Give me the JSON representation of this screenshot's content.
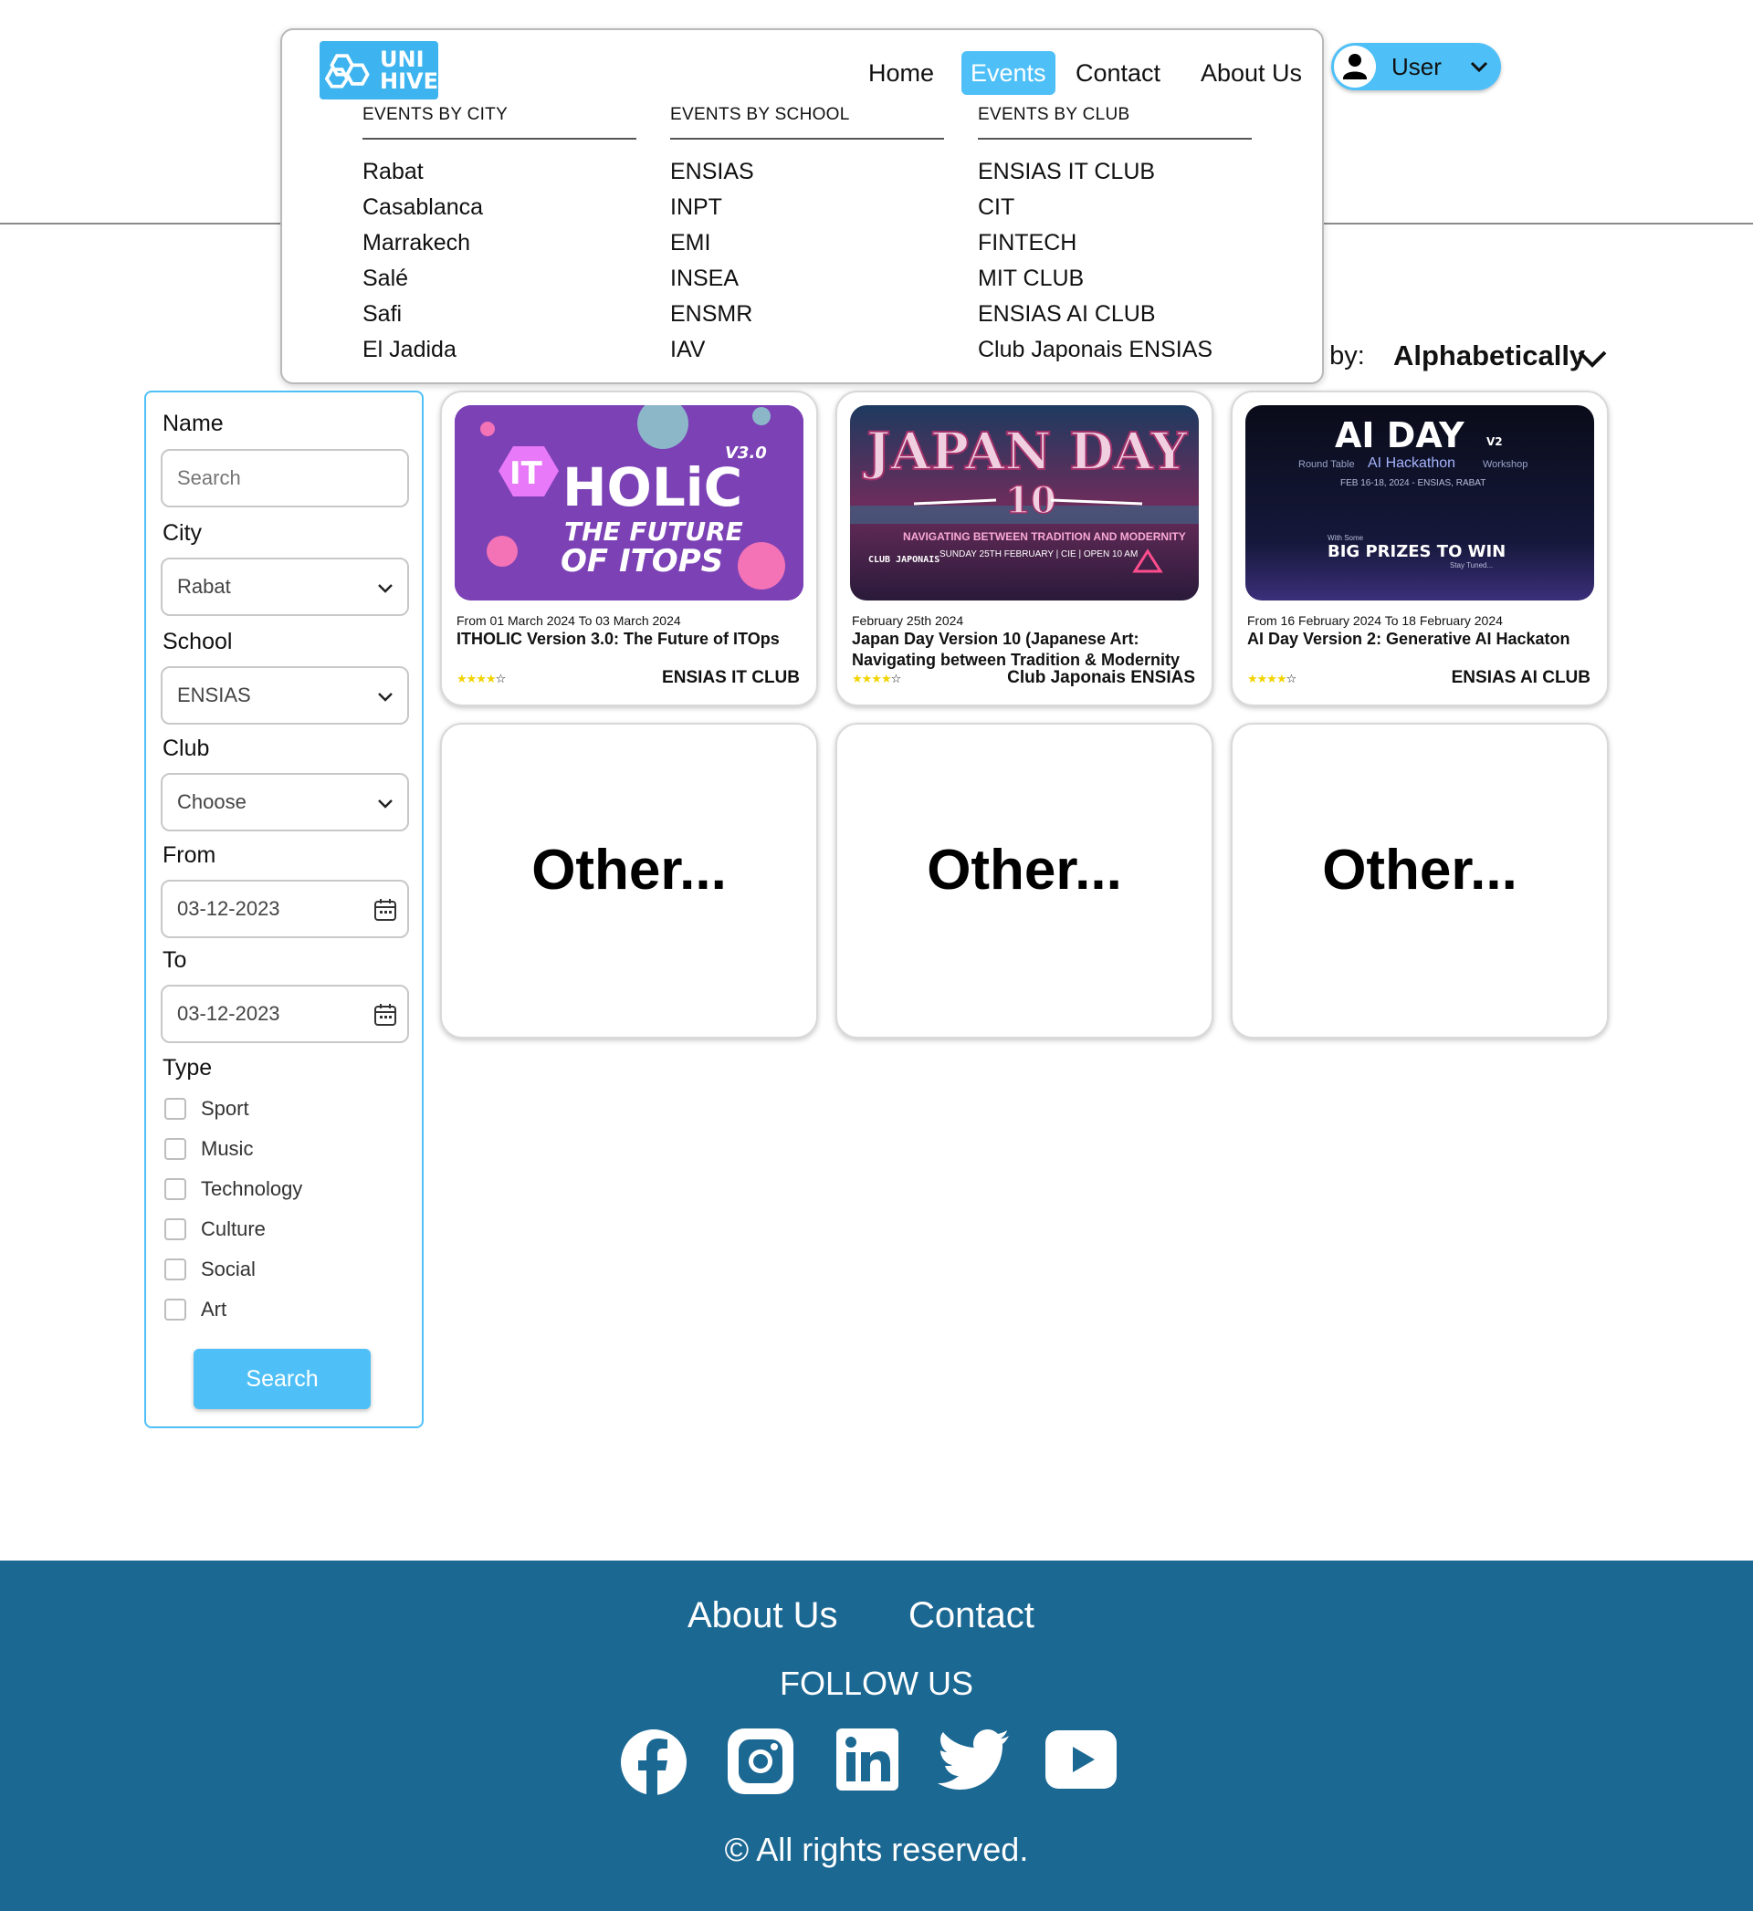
{
  "nav": {
    "logo_text_1": "UNI",
    "logo_text_2": "HIVE",
    "links": [
      "Home",
      "Events",
      "Contact",
      "About Us"
    ],
    "active": "Events",
    "user_label": "User"
  },
  "mega_menu": {
    "columns": [
      {
        "heading": "EVENTS BY CITY",
        "items": [
          "Rabat",
          "Casablanca",
          "Marrakech",
          "Salé",
          "Safi",
          "El Jadida"
        ]
      },
      {
        "heading": "EVENTS BY SCHOOL",
        "items": [
          "ENSIAS",
          "INPT",
          "EMI",
          "INSEA",
          "ENSMR",
          "IAV"
        ]
      },
      {
        "heading": "EVENTS BY CLUB",
        "items": [
          "ENSIAS IT CLUB",
          "CIT",
          "FINTECH",
          "MIT CLUB",
          "ENSIAS AI CLUB",
          "Club Japonais ENSIAS"
        ]
      }
    ]
  },
  "sort": {
    "label": "t by:",
    "value": "Alphabetically"
  },
  "filters": {
    "name_label": "Name",
    "name_placeholder": "Search",
    "city_label": "City",
    "city_value": "Rabat",
    "school_label": "School",
    "school_value": "ENSIAS",
    "club_label": "Club",
    "club_value": "Choose",
    "from_label": "From",
    "from_value": "03-12-2023",
    "to_label": "To",
    "to_value": "03-12-2023",
    "type_label": "Type",
    "types": [
      "Sport",
      "Music",
      "Technology",
      "Culture",
      "Social",
      "Art"
    ],
    "search_button": "Search"
  },
  "events": [
    {
      "date": "From 01 March 2024 To 03 March 2024",
      "title": "ITHOLIC Version 3.0: The Future of ITOps",
      "rating": 4,
      "club": "ENSIAS IT CLUB",
      "poster": {
        "badge": "IT",
        "main": "HOLiC",
        "version": "V3.0",
        "tagline_1": "THE FUTURE",
        "tagline_2": "OF ITOPS"
      }
    },
    {
      "date": "February 25th 2024",
      "title": "Japan Day Version 10 (Japanese Art: Navigating between Tradition & Modernity",
      "rating": 4,
      "club": "Club Japonais ENSIAS",
      "poster": {
        "main": "JAPAN DAY",
        "number": "10",
        "line_1": "NAVIGATING BETWEEN TRADITION AND MODERNITY",
        "line_2": "SUNDAY 25TH FEBRUARY | CIE | OPEN 10 AM",
        "club_mark": "CLUB JAPONAIS"
      }
    },
    {
      "date": "From 16 February 2024 To 18 February 2024",
      "title": "AI Day Version 2: Generative AI Hackaton",
      "rating": 4,
      "club": "ENSIAS AI CLUB",
      "poster": {
        "main": "AI DAY",
        "version": "V2",
        "sub_1": "Round Table",
        "sub_2": "AI Hackathon",
        "sub_3": "Workshop",
        "dates": "FEB 16-18, 2024 - ENSIAS, RABAT",
        "small": "With Some",
        "prize": "BIG PRIZES TO WIN",
        "stay": "Stay Tuned..."
      }
    }
  ],
  "placeholders": [
    "Other...",
    "Other...",
    "Other..."
  ],
  "footer": {
    "links": [
      "About Us",
      "Contact"
    ],
    "follow": "FOLLOW US",
    "social_icons": [
      "facebook-icon",
      "instagram-icon",
      "linkedin-icon",
      "twitter-icon",
      "youtube-icon"
    ],
    "copyright": "© All rights reserved."
  },
  "colors": {
    "accent": "#4fc0f7",
    "footer": "#1b6893",
    "star": "#f2d300"
  }
}
